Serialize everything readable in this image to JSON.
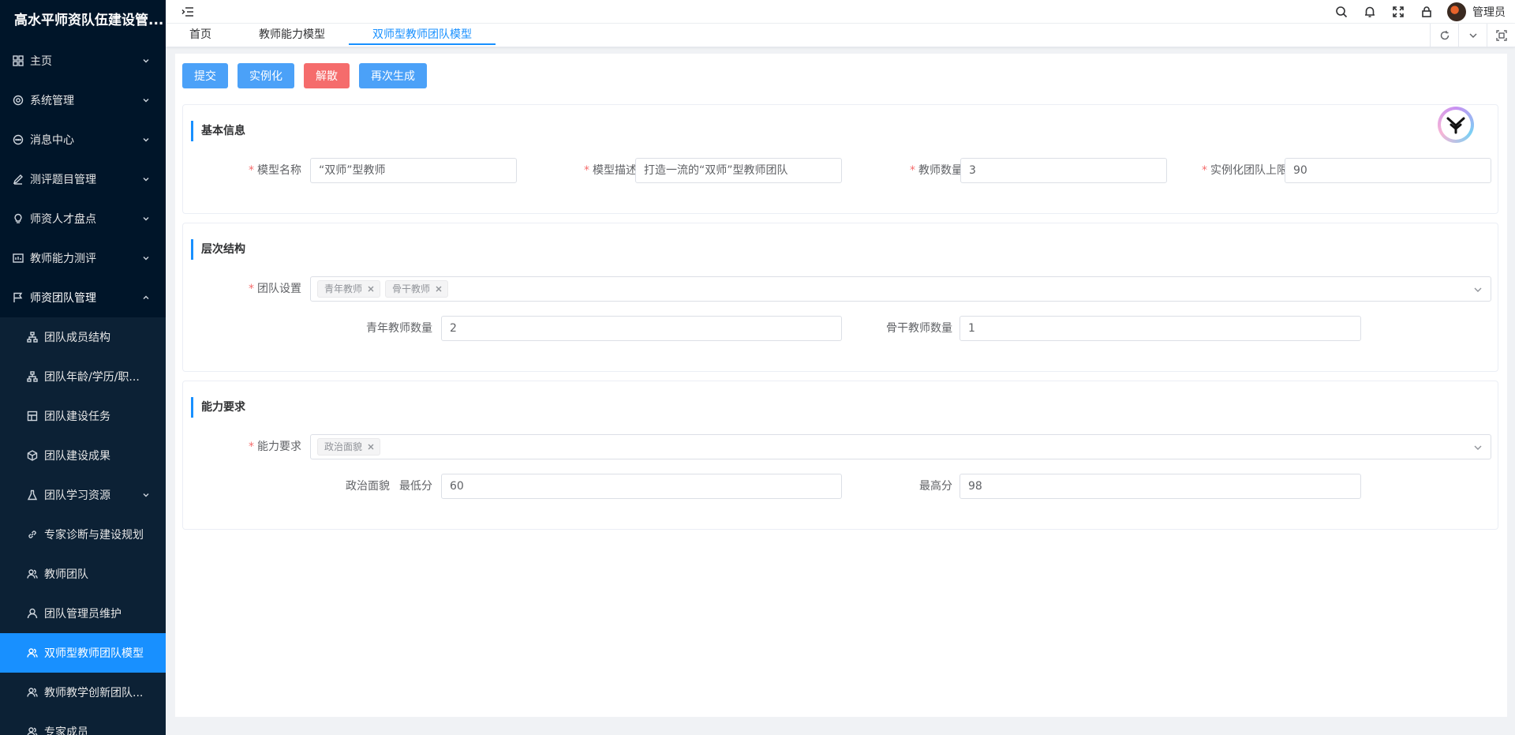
{
  "app": {
    "title": "高水平师资队伍建设管..."
  },
  "sidebar": {
    "items": [
      {
        "label": "主页",
        "icon": "grid-icon"
      },
      {
        "label": "系统管理",
        "icon": "gear-icon"
      },
      {
        "label": "消息中心",
        "icon": "chat-icon"
      },
      {
        "label": "测评题目管理",
        "icon": "edit-icon"
      },
      {
        "label": "师资人才盘点",
        "icon": "bulb-icon"
      },
      {
        "label": "教师能力测评",
        "icon": "chart-icon"
      },
      {
        "label": "师资团队管理",
        "icon": "flag-icon"
      }
    ],
    "subitems": [
      {
        "label": "团队成员结构",
        "icon": "tree-icon"
      },
      {
        "label": "团队年龄/学历/职...",
        "icon": "tree-icon"
      },
      {
        "label": "团队建设任务",
        "icon": "table-icon"
      },
      {
        "label": "团队建设成果",
        "icon": "cube-icon"
      },
      {
        "label": "团队学习资源",
        "icon": "flask-icon"
      },
      {
        "label": "专家诊断与建设规划",
        "icon": "link-icon"
      },
      {
        "label": "教师团队",
        "icon": "people-icon"
      },
      {
        "label": "团队管理员维护",
        "icon": "user-icon"
      },
      {
        "label": "双师型教师团队模型",
        "icon": "people-icon"
      },
      {
        "label": "教师教学创新团队...",
        "icon": "people-icon"
      },
      {
        "label": "专家成员",
        "icon": "people-icon"
      }
    ]
  },
  "header": {
    "username": "管理员"
  },
  "tabs": [
    {
      "label": "首页"
    },
    {
      "label": "教师能力模型"
    },
    {
      "label": "双师型教师团队模型"
    }
  ],
  "toolbar": {
    "submit_label": "提交",
    "instantiate_label": "实例化",
    "dissolve_label": "解散",
    "regenerate_label": "再次生成"
  },
  "basic_info": {
    "title": "基本信息",
    "model_name_label": "模型名称",
    "model_name_value": "“双师”型教师",
    "model_desc_label": "模型描述",
    "model_desc_value": "打造一流的“双师”型教师团队",
    "teacher_count_label": "教师数量",
    "teacher_count_value": "3",
    "team_limit_label": "实例化团队上限",
    "team_limit_value": "90"
  },
  "hierarchy": {
    "title": "层次结构",
    "team_setting_label": "团队设置",
    "tags": [
      "青年教师",
      "骨干教师"
    ],
    "young_count_label": "青年教师数量",
    "young_count_value": "2",
    "backbone_count_label": "骨干教师数量",
    "backbone_count_value": "1"
  },
  "ability": {
    "title": "能力要求",
    "ability_label": "能力要求",
    "tags": [
      "政治面貌"
    ],
    "item_name": "政治面貌",
    "min_label": "最低分",
    "min_value": "60",
    "max_label": "最高分",
    "max_value": "98"
  },
  "colors": {
    "primary": "#1890ff",
    "danger": "#f56c6c",
    "sidebar_bg": "#001529"
  }
}
